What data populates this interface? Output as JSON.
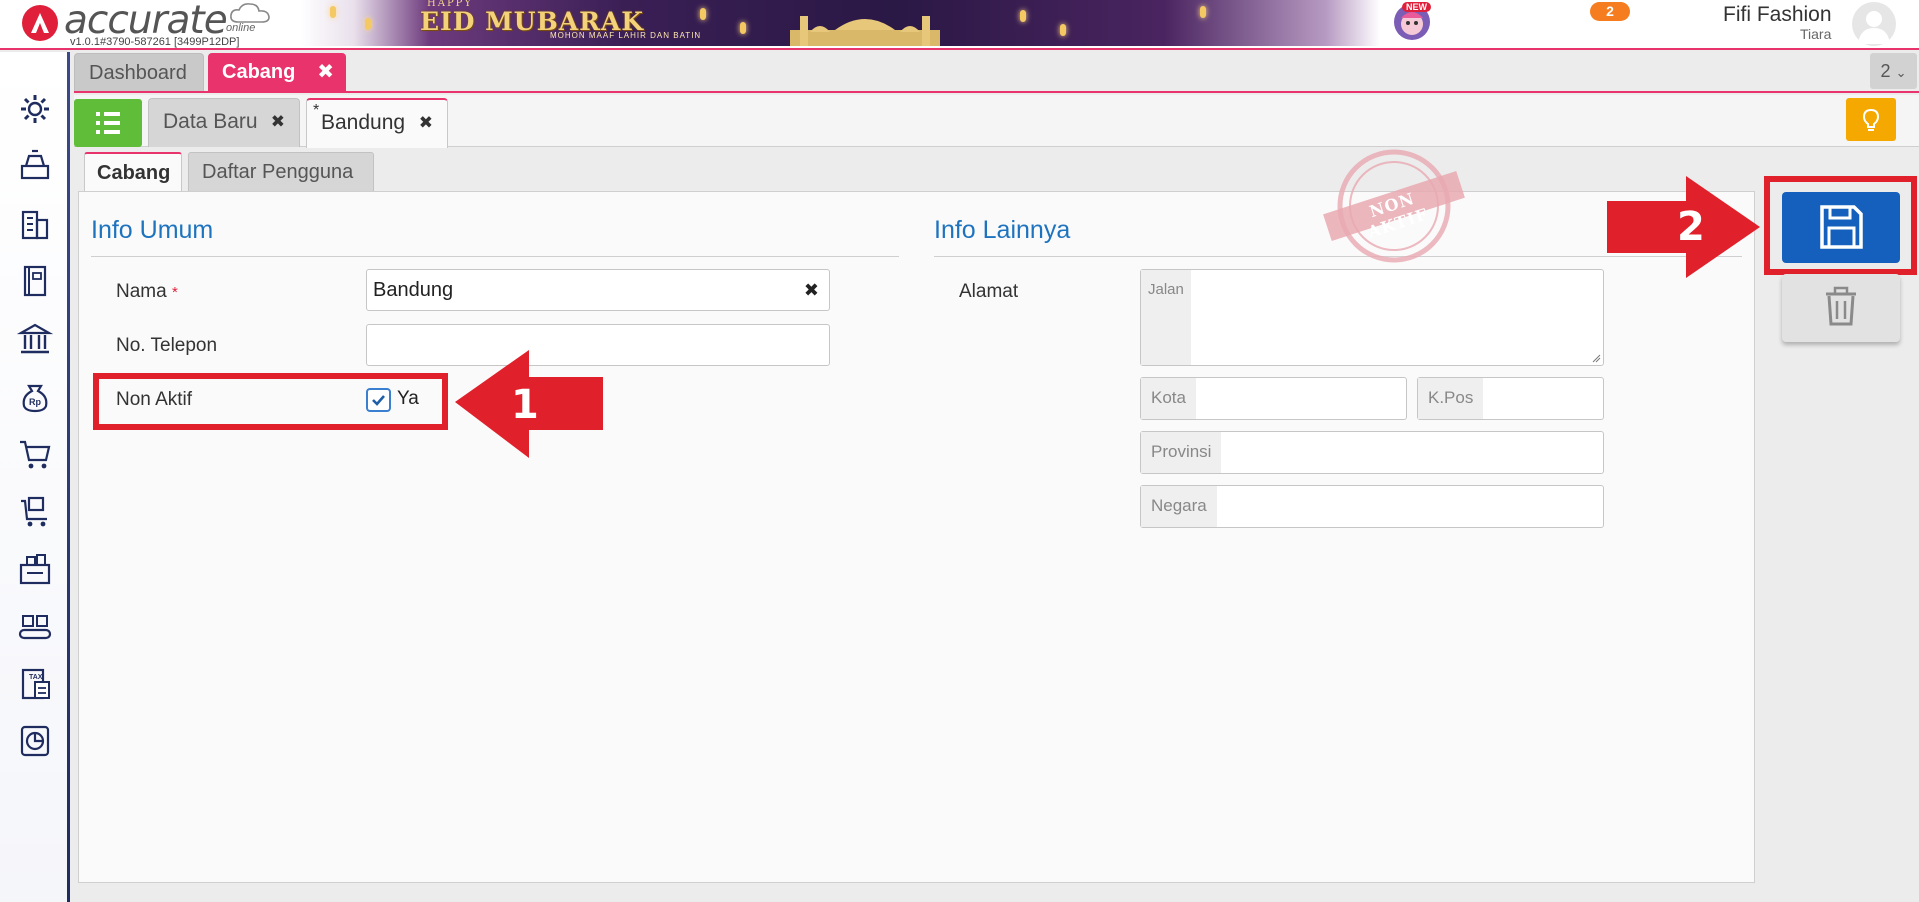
{
  "header": {
    "logo_text": "accurate",
    "logo_sub": "online",
    "version": "v1.0.1#3790-587261 [3499P12DP]",
    "banner": {
      "happy": "HAPPY",
      "title": "EID MUBARAK",
      "subtitle": "MOHON MAAF LAHIR DAN BATIN"
    },
    "new_badge": "NEW",
    "notification_count": "2",
    "user_name": "Fifi Fashion",
    "user_sub": "Tiara"
  },
  "module_tabs": [
    {
      "label": "Dashboard"
    },
    {
      "label": "Cabang",
      "close": "✖"
    }
  ],
  "module_tab_count": "2",
  "sub_tabs": [
    {
      "label": "Data Baru",
      "close": "✖"
    },
    {
      "label": "Bandung",
      "modified_marker": "*",
      "close": "✖"
    }
  ],
  "inner_tabs": [
    {
      "label": "Cabang"
    },
    {
      "label": "Daftar Pengguna"
    }
  ],
  "info_umum": {
    "title": "Info Umum",
    "nama_label": "Nama",
    "required_mark": "*",
    "nama_value": "Bandung",
    "nama_clear": "✖",
    "telepon_label": "No. Telepon",
    "telepon_value": "",
    "non_aktif_label": "Non Aktif",
    "non_aktif_checked": true,
    "non_aktif_option": "Ya"
  },
  "info_lainnya": {
    "title": "Info Lainnya",
    "alamat_label": "Alamat",
    "jalan_prefix": "Jalan",
    "kota_prefix": "Kota",
    "kpos_prefix": "K.Pos",
    "provinsi_prefix": "Provinsi",
    "negara_prefix": "Negara"
  },
  "stamp_text": "NON AKTIF",
  "annotations": {
    "step1": "1",
    "step2": "2",
    "highlight_color": "#e0202a"
  },
  "colors": {
    "accent_pink": "#e8336d",
    "primary_blue": "#1560bd",
    "title_blue": "#1e73be",
    "list_green": "#5fbd3a",
    "bulb_orange": "#f5a800"
  }
}
